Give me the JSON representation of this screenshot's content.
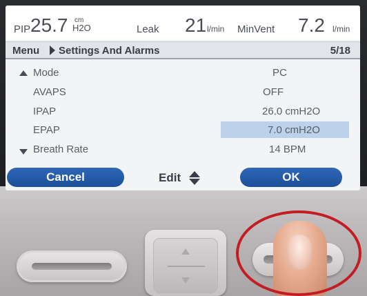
{
  "status": {
    "pip_label": "PIP",
    "pip_value": "25.7",
    "pip_unit_top": "cm",
    "pip_unit_bottom": "H2O",
    "leak_label": "Leak",
    "leak_value": "21",
    "leak_unit": "l/min",
    "minvent_label": "MinVent",
    "minvent_value": "7.2",
    "minvent_unit": "l/min"
  },
  "menubar": {
    "menu_label": "Menu",
    "page_title": "Settings And Alarms",
    "page_counter": "5/18"
  },
  "settings": [
    {
      "label": "Mode",
      "value": "PC",
      "selected": false
    },
    {
      "label": "AVAPS",
      "value": "OFF",
      "selected": false
    },
    {
      "label": "IPAP",
      "value": "26.0 cmH2O",
      "selected": false
    },
    {
      "label": "EPAP",
      "value": "7.0 cmH2O",
      "selected": true
    },
    {
      "label": "Breath Rate",
      "value": "14 BPM",
      "selected": false
    }
  ],
  "softkeys": {
    "cancel_label": "Cancel",
    "edit_label": "Edit",
    "ok_label": "OK"
  },
  "colors": {
    "softkey_blue": "#2459a8",
    "selection_highlight": "#bcd1ea",
    "annotation_circle": "#c21d22"
  },
  "icons": {
    "scroll_up": "triangle-up-icon",
    "scroll_down": "triangle-down-icon",
    "breadcrumb_separator": "triangle-right-icon",
    "edit_updown": "up-down-arrows-icon"
  }
}
